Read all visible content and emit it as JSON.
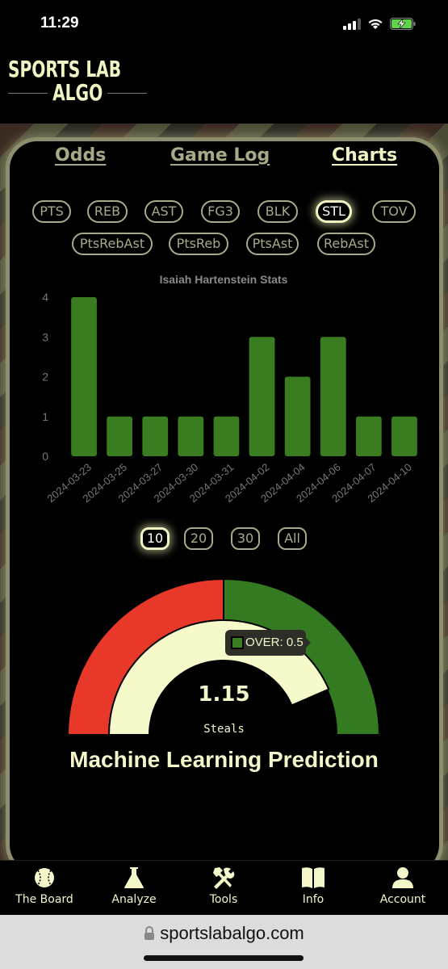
{
  "status_bar": {
    "time": "11:29",
    "icons": [
      "cellular-signal-icon",
      "wifi-icon",
      "battery-charging-icon"
    ]
  },
  "header": {
    "logo_top": "SPORTS LAB",
    "logo_bottom": "ALGO"
  },
  "tabs": [
    {
      "label": "Odds",
      "active": false
    },
    {
      "label": "Game Log",
      "active": false
    },
    {
      "label": "Charts",
      "active": true
    }
  ],
  "stat_pills_row1": [
    {
      "label": "PTS",
      "active": false
    },
    {
      "label": "REB",
      "active": false
    },
    {
      "label": "AST",
      "active": false
    },
    {
      "label": "FG3",
      "active": false
    },
    {
      "label": "BLK",
      "active": false
    },
    {
      "label": "STL",
      "active": true
    },
    {
      "label": "TOV",
      "active": false
    }
  ],
  "stat_pills_row2": [
    {
      "label": "PtsRebAst",
      "active": false
    },
    {
      "label": "PtsReb",
      "active": false
    },
    {
      "label": "PtsAst",
      "active": false
    },
    {
      "label": "RebAst",
      "active": false
    }
  ],
  "chart_data": {
    "type": "bar",
    "title": "Isaiah Hartenstein Stats",
    "xlabel": "",
    "ylabel": "",
    "categories": [
      "2024-03-23",
      "2024-03-25",
      "2024-03-27",
      "2024-03-30",
      "2024-03-31",
      "2024-04-02",
      "2024-04-04",
      "2024-04-06",
      "2024-04-07",
      "2024-04-10"
    ],
    "values": [
      4,
      1,
      1,
      1,
      1,
      3,
      2,
      3,
      1,
      1
    ],
    "ylim": [
      0,
      4
    ],
    "yticks": [
      0,
      1,
      2,
      3,
      4
    ],
    "grid": false,
    "bar_color": "#3a7d20",
    "legend": "none"
  },
  "range_pills": [
    {
      "label": "10",
      "active": true
    },
    {
      "label": "20",
      "active": false
    },
    {
      "label": "30",
      "active": false
    },
    {
      "label": "All",
      "active": false
    }
  ],
  "gauge": {
    "value": "1.15",
    "unit": "Steals",
    "line": 0.5,
    "tooltip": "OVER: 0.5",
    "under_color": "#e8382a",
    "over_color": "#347a21",
    "prediction_color": "#f6f9c9",
    "prediction_fraction": 0.87,
    "title": "Machine Learning Prediction"
  },
  "bottom_nav": [
    {
      "label": "The Board",
      "icon": "baseball-icon"
    },
    {
      "label": "Analyze",
      "icon": "flask-icon"
    },
    {
      "label": "Tools",
      "icon": "tools-icon"
    },
    {
      "label": "Info",
      "icon": "book-icon"
    },
    {
      "label": "Account",
      "icon": "user-icon"
    }
  ],
  "browser": {
    "url": "sportslabalgo.com"
  }
}
